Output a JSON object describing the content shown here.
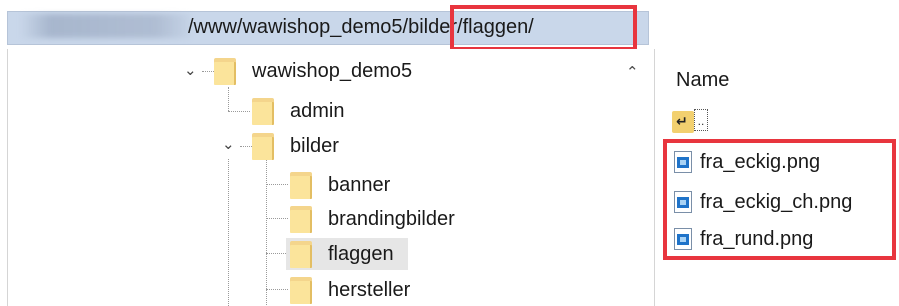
{
  "path_bar": {
    "visible_path": "/www/wawishop_demo5/bilder/flaggen/"
  },
  "tree": {
    "items": [
      {
        "label": "wawishop_demo5",
        "expanded": true
      },
      {
        "label": "admin"
      },
      {
        "label": "bilder",
        "expanded": true
      },
      {
        "label": "banner"
      },
      {
        "label": "brandingbilder"
      },
      {
        "label": "flaggen",
        "selected": true
      },
      {
        "label": "hersteller"
      }
    ]
  },
  "file_list": {
    "column_header": "Name",
    "up_item": "..",
    "files": [
      {
        "name": "fra_eckig.png",
        "icon": "png-image-icon"
      },
      {
        "name": "fra_eckig_ch.png",
        "icon": "png-image-icon"
      },
      {
        "name": "fra_rund.png",
        "icon": "png-image-icon"
      }
    ]
  },
  "colors": {
    "highlight": "#e8353e",
    "path_bar_bg": "#c9d7ea",
    "folder": "#fbe49b",
    "selection": "#e6e6e6"
  }
}
